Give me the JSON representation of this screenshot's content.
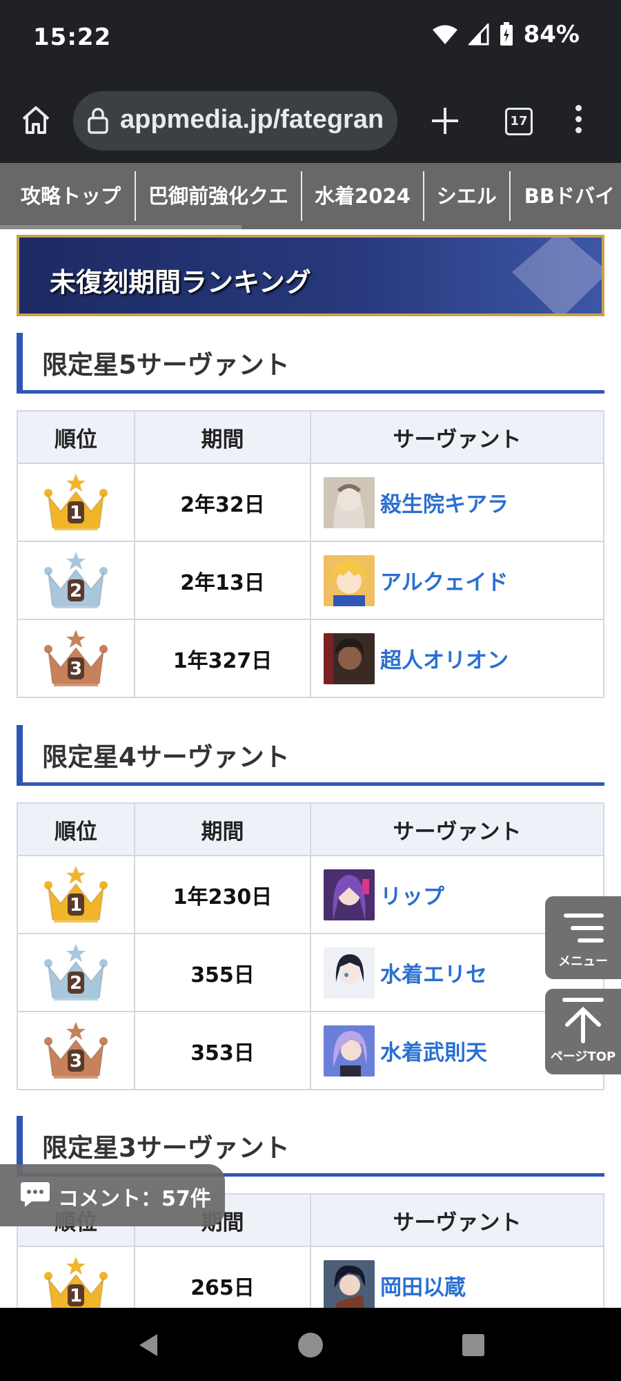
{
  "status": {
    "time": "15:22",
    "battery": "84%"
  },
  "browser": {
    "url": "appmedia.jp/fategran",
    "tab_count": "17"
  },
  "nav": {
    "items": [
      "攻略トップ",
      "巴御前強化クエ",
      "水着2024",
      "シエル",
      "BBドバイ"
    ]
  },
  "banner": {
    "title": "未復刻期間ランキング"
  },
  "table_header": {
    "rank": "順位",
    "period": "期間",
    "servant": "サーヴァント"
  },
  "sections": [
    {
      "title": "限定星5サーヴァント",
      "rows": [
        {
          "rank": "1",
          "period": "2年32日",
          "servant": "殺生院キアラ"
        },
        {
          "rank": "2",
          "period": "2年13日",
          "servant": "アルクェイド"
        },
        {
          "rank": "3",
          "period": "1年327日",
          "servant": "超人オリオン"
        }
      ]
    },
    {
      "title": "限定星4サーヴァント",
      "rows": [
        {
          "rank": "1",
          "period": "1年230日",
          "servant": "リップ"
        },
        {
          "rank": "2",
          "period": "355日",
          "servant": "水着エリセ"
        },
        {
          "rank": "3",
          "period": "353日",
          "servant": "水着武則天"
        }
      ]
    },
    {
      "title": "限定星3サーヴァント",
      "rows": [
        {
          "rank": "1",
          "period": "265日",
          "servant": "岡田以蔵"
        }
      ]
    }
  ],
  "side_buttons": {
    "menu": "メニュー",
    "top": "ページTOP"
  },
  "comment": {
    "label": "コメント：57件"
  },
  "colors": {
    "gold": "#f2b52a",
    "silver": "#a9c7dc",
    "bronze": "#c7825c",
    "link": "#2a6fd1",
    "accent": "#2f56b5"
  }
}
